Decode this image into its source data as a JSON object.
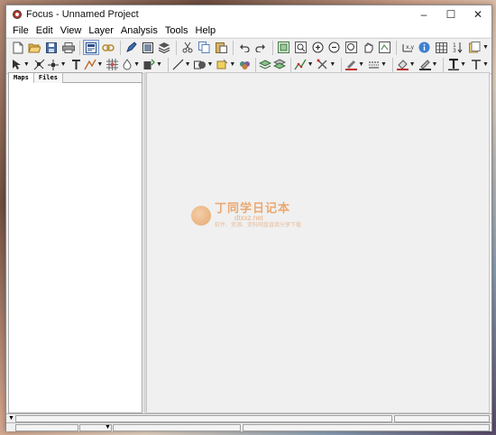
{
  "window": {
    "title": "Focus - Unnamed Project"
  },
  "window_controls": {
    "minimize": "–",
    "maximize": "☐",
    "close": "✕"
  },
  "menu": [
    "File",
    "Edit",
    "View",
    "Layer",
    "Analysis",
    "Tools",
    "Help"
  ],
  "left_panel": {
    "tabs": [
      "Maps",
      "Files"
    ]
  },
  "watermark": {
    "title": "丁同学日记本",
    "url": "dtxxz.net",
    "subtitle": "软件、资源、资料网盘直接分享下载"
  },
  "colors": {
    "window_bg": "#f0f0f0",
    "panel_bg": "#ffffff",
    "active_button": "#d6e4f7"
  }
}
